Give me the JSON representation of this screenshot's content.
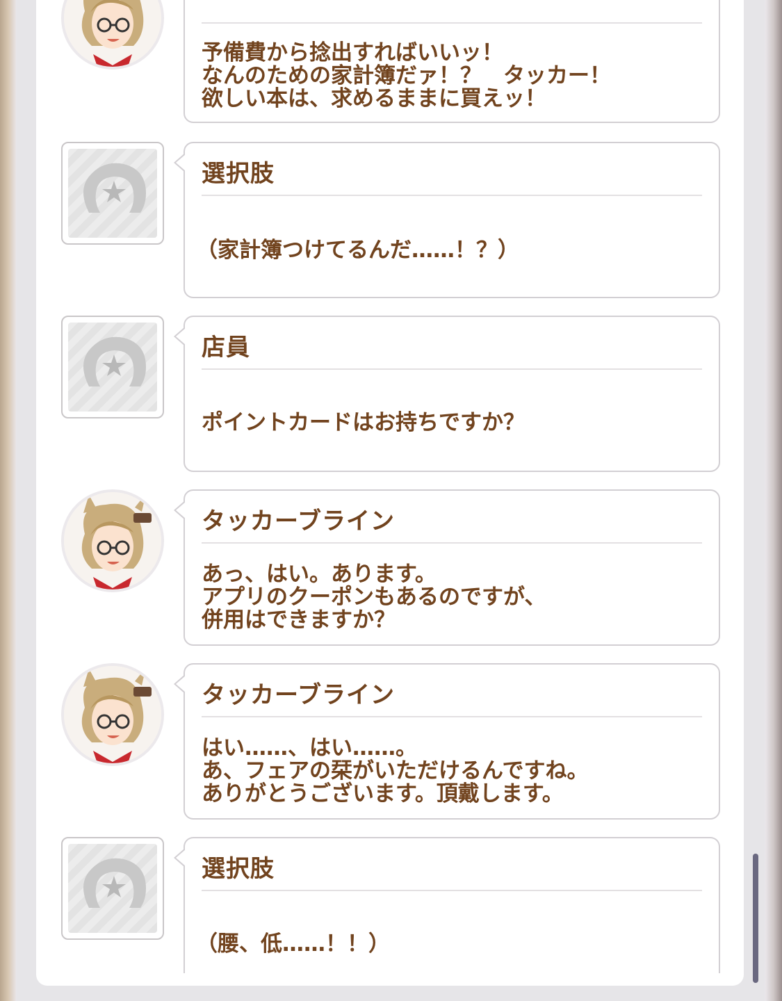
{
  "dialogue": [
    {
      "speaker": "",
      "avatar": "character-portrait",
      "lines": [
        "予備費から捻出すればいいッ！",
        "なんのための家計簿だァ！？　タッカー！",
        "欲しい本は、求めるままに買えッ！"
      ]
    },
    {
      "speaker": "選択肢",
      "avatar": "horseshoe-placeholder",
      "lines": [
        "（家計簿つけてるんだ……！？）"
      ]
    },
    {
      "speaker": "店員",
      "avatar": "horseshoe-placeholder",
      "lines": [
        "ポイントカードはお持ちですか？"
      ]
    },
    {
      "speaker": "タッカーブライン",
      "avatar": "character-portrait",
      "lines": [
        "あっ、はい。あります。",
        "アプリのクーポンもあるのですが、",
        "併用はできますか？"
      ]
    },
    {
      "speaker": "タッカーブライン",
      "avatar": "character-portrait",
      "lines": [
        "はい……、はい……。",
        "あ、フェアの栞がいただけるんですね。",
        "ありがとうございます。頂戴します。"
      ]
    },
    {
      "speaker": "選択肢",
      "avatar": "horseshoe-placeholder",
      "lines": [
        "（腰、低……！！）"
      ]
    }
  ],
  "colors": {
    "text_brown": "#71431e",
    "bubble_border": "#d2cfd3",
    "scrollbar": "#6a6880"
  }
}
